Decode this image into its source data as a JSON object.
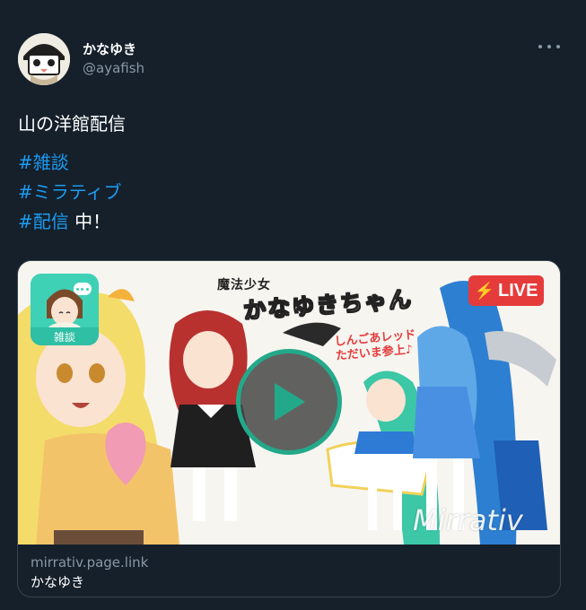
{
  "author": {
    "display_name": "かなゆき",
    "handle": "@ayafish"
  },
  "tweet": {
    "text_main": "山の洋館配信",
    "hashtags": [
      "#雑談",
      "#ミラティブ",
      "#配信"
    ],
    "trailing_text": " 中！"
  },
  "card": {
    "domain": "mirrativ.page.link",
    "title": "かなゆき",
    "live_label": "LIVE",
    "thumbnail_title_line1": "魔法少女",
    "thumbnail_title_line2": "かなゆきちゃん",
    "thumbnail_subtitle_line1": "しんごあレッド",
    "thumbnail_subtitle_line2": "ただいま参上♪",
    "category_label": "雑談",
    "watermark": "Mirrativ"
  },
  "colors": {
    "background": "#15202b",
    "hashtag": "#1d9bf0",
    "secondary_text": "#8899a6",
    "live_red": "#e53b3b",
    "play_ring": "#23a98a"
  },
  "icons": {
    "more": "more-horizontal-icon",
    "play": "play-icon",
    "live": "lightning-icon"
  }
}
